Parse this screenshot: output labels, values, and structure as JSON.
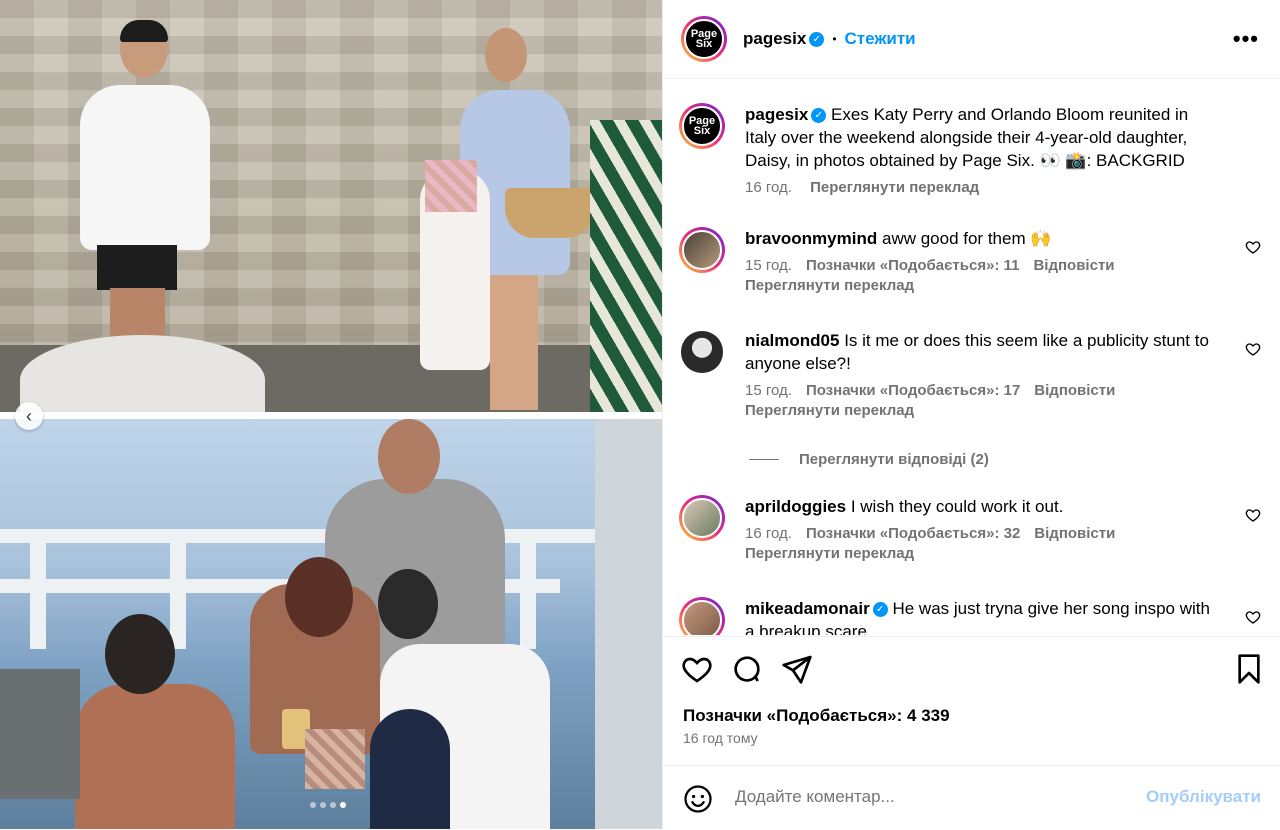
{
  "post": {
    "author": "pagesix",
    "follow_label": "Стежити",
    "separator": "•",
    "more_label": "•••",
    "avatar_text": "Page Six"
  },
  "caption": {
    "author": "pagesix",
    "text": "Exes Katy Perry and Orlando Bloom reunited in Italy over the weekend alongside their 4-year-old daughter, Daisy, in photos obtained by Page Six. 👀 📸: BACKGRID",
    "time": "16 год.",
    "translate": "Переглянути переклад"
  },
  "comments": [
    {
      "author": "bravoonmymind",
      "text": "aww good for them 🙌",
      "time": "15 год.",
      "likes": "Позначки «Подобається»: 11",
      "reply": "Відповісти",
      "translate": "Переглянути переклад",
      "verified": false
    },
    {
      "author": "nialmond05",
      "text": "Is it me or does this seem like a publicity stunt to anyone else?!",
      "time": "15 год.",
      "likes": "Позначки «Подобається»: 17",
      "reply": "Відповісти",
      "translate": "Переглянути переклад",
      "verified": false
    },
    {
      "author": "aprildoggies",
      "text": "I wish they could work it out.",
      "time": "16 год.",
      "likes": "Позначки «Подобається»: 32",
      "reply": "Відповісти",
      "translate": "Переглянути переклад",
      "verified": false
    },
    {
      "author": "mikeadamonair",
      "text": "He was just tryna give her song inspo with a breakup scare",
      "verified": true
    }
  ],
  "view_replies": "Переглянути відповіді (2)",
  "actions": {
    "likes": "Позначки «Подобається»: 4 339",
    "time_ago": "16 год тому"
  },
  "comment_box": {
    "placeholder": "Додайте коментар...",
    "publish_label": "Опублікувати"
  },
  "carousel": {
    "total": 4,
    "active": 3
  },
  "colors": {
    "accent": "#0095f6",
    "muted": "#737373",
    "publish_disabled": "#a5cdf7"
  },
  "icons": [
    "heart-icon",
    "comment-icon",
    "share-icon",
    "bookmark-icon",
    "emoji-icon",
    "verified-icon",
    "chevron-left-icon",
    "more-icon"
  ]
}
